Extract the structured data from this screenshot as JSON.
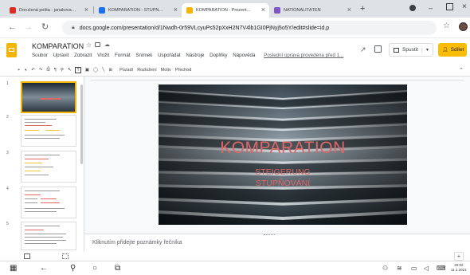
{
  "browser": {
    "tabs": [
      {
        "title": "Doručená pošta - janakova@...",
        "favicon_color": "#d93025",
        "active": false
      },
      {
        "title": "KOMPARATION - STUPŇOVÁ...",
        "favicon_color": "#1a73e8",
        "active": false
      },
      {
        "title": "KOMPARATION - Prezentace G...",
        "favicon_color": "#f4b400",
        "active": true
      },
      {
        "title": "NATIONALITÄTEN",
        "favicon_color": "#7e57c2",
        "active": false
      }
    ],
    "new_tab_label": "+",
    "url": "docs.google.com/presentation/d/1Nwdh-0r59VLcyuPs52pXxH2N7V4lb1GI0PjNyj5o5Y/edit#slide=id.p"
  },
  "app": {
    "doc_title": "KOMPARATION",
    "menu": [
      "Soubor",
      "Upravit",
      "Zobrazit",
      "Vložit",
      "Formát",
      "Snímek",
      "Uspořádat",
      "Nástroje",
      "Doplňky",
      "Nápověda"
    ],
    "last_edit": "Poslední úprava provedena před 1...",
    "present_label": "Spustit",
    "share_label": "Sdílet"
  },
  "toolbar": {
    "background_label": "Pozadí",
    "layout_label": "Rozložení",
    "theme_label": "Motiv",
    "transition_label": "Přechod"
  },
  "filmstrip": {
    "slide_numbers": [
      "1",
      "2",
      "3",
      "4",
      "5"
    ]
  },
  "slide": {
    "title": "KOMPARATION",
    "line1": "STEIGERUNG",
    "line2": "STUPŇOVÁNÍ"
  },
  "notes": {
    "placeholder": "Kliknutím přidejte poznámky řečníka"
  },
  "taskbar": {
    "time": "20:02",
    "date": "11.1.2021"
  },
  "colors": {
    "slides_yellow": "#f4b400",
    "share_button": "#fbbc04",
    "slide_title": "#e06666",
    "slide_subtitle": "#e06666"
  }
}
